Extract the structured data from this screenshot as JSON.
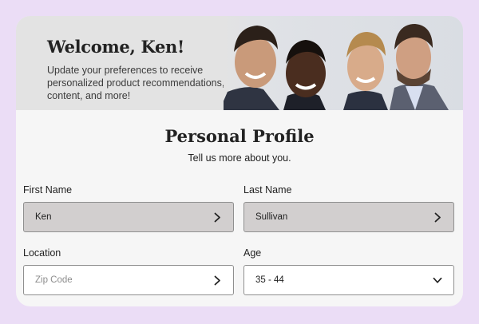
{
  "banner": {
    "title": "Welcome, Ken!",
    "subtitle": "Update your preferences to receive personalized product recommendations, content, and more!"
  },
  "profile": {
    "title": "Personal Profile",
    "subtitle": "Tell us more about you."
  },
  "fields": {
    "first_name": {
      "label": "First Name",
      "value": "Ken",
      "icon": "chevron-right-icon"
    },
    "last_name": {
      "label": "Last Name",
      "value": "Sullivan",
      "icon": "chevron-right-icon"
    },
    "location": {
      "label": "Location",
      "placeholder": "Zip Code",
      "icon": "chevron-right-icon"
    },
    "age": {
      "label": "Age",
      "value": "35 - 44",
      "icon": "chevron-down-icon"
    }
  },
  "colors": {
    "page_background": "#ebddf6",
    "card_background": "#f6f6f6",
    "filled_field": "#d2cfcf",
    "text": "#222222"
  }
}
